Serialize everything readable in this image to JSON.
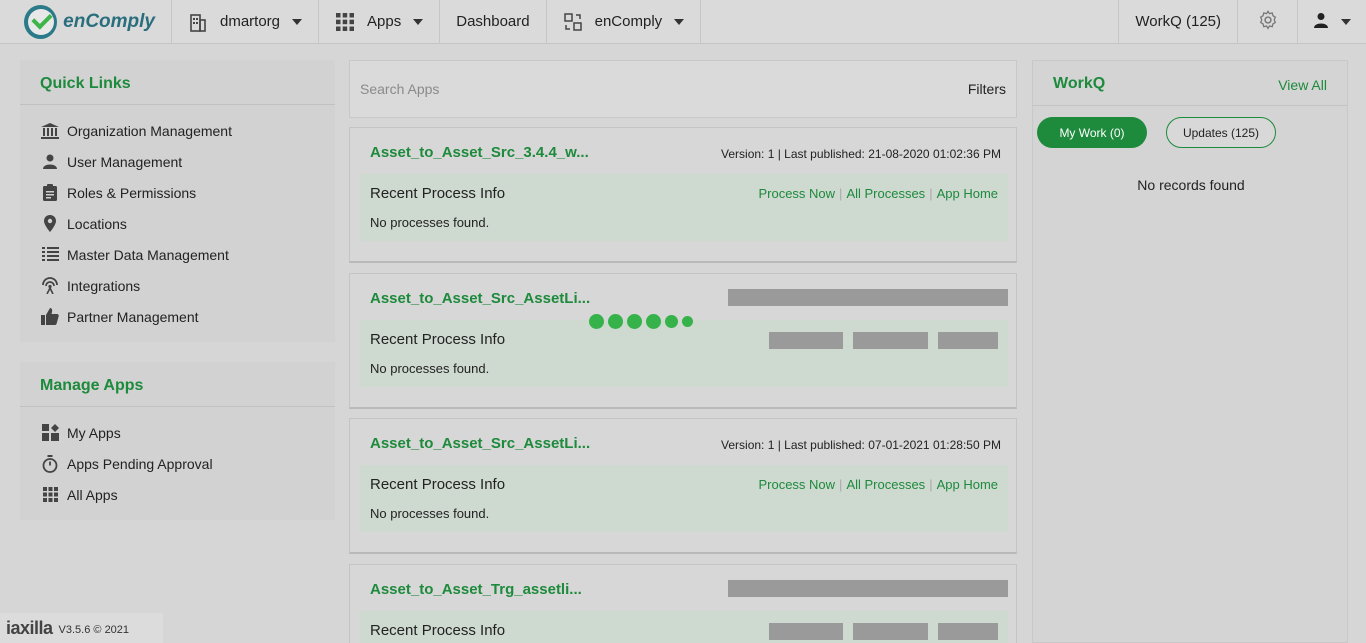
{
  "topbar": {
    "brand": "enComply",
    "org": "dmartorg",
    "apps_label": "Apps",
    "dashboard_label": "Dashboard",
    "product_label": "enComply",
    "workq_label": "WorkQ (125)"
  },
  "quick_links": {
    "title": "Quick Links",
    "items": [
      {
        "label": "Organization Management",
        "icon": "bank-icon"
      },
      {
        "label": "User Management",
        "icon": "user-icon"
      },
      {
        "label": "Roles & Permissions",
        "icon": "clipboard-icon"
      },
      {
        "label": "Locations",
        "icon": "map-pin-icon"
      },
      {
        "label": "Master Data Management",
        "icon": "list-icon"
      },
      {
        "label": "Integrations",
        "icon": "broadcast-icon"
      },
      {
        "label": "Partner Management",
        "icon": "thumbs-up-icon"
      }
    ]
  },
  "manage_apps": {
    "title": "Manage Apps",
    "items": [
      {
        "label": "My Apps",
        "icon": "app-grid-icon"
      },
      {
        "label": "Apps Pending Approval",
        "icon": "stopwatch-icon"
      },
      {
        "label": "All Apps",
        "icon": "grid-icon"
      }
    ]
  },
  "search": {
    "placeholder": "Search Apps",
    "filters_label": "Filters"
  },
  "apps": [
    {
      "title": "Asset_to_Asset_Src_3.4.4_w...",
      "version": "Version: 1 | Last published: 21-08-2020 01:02:36 PM",
      "section": "Recent Process Info",
      "status": "No processes found.",
      "links": [
        "Process Now",
        "All Processes",
        "App Home"
      ],
      "loading": false
    },
    {
      "title": "Asset_to_Asset_Src_AssetLi...",
      "section": "Recent Process Info",
      "status": "No processes found.",
      "loading": true
    },
    {
      "title": "Asset_to_Asset_Src_AssetLi...",
      "version": "Version: 1 | Last published: 07-01-2021 01:28:50 PM",
      "section": "Recent Process Info",
      "status": "No processes found.",
      "links": [
        "Process Now",
        "All Processes",
        "App Home"
      ],
      "loading": false
    },
    {
      "title": "Asset_to_Asset_Trg_assetli...",
      "section": "Recent Process Info",
      "loading": true
    }
  ],
  "workq": {
    "title": "WorkQ",
    "view_all": "View All",
    "my_work": "My Work (0)",
    "updates": "Updates (125)",
    "empty": "No records found"
  },
  "footer": {
    "brand": "iaxilla",
    "version": "V3.5.6 © 2021"
  },
  "colors": {
    "accent": "#1d8a3c",
    "spinner": "#36b24a"
  }
}
